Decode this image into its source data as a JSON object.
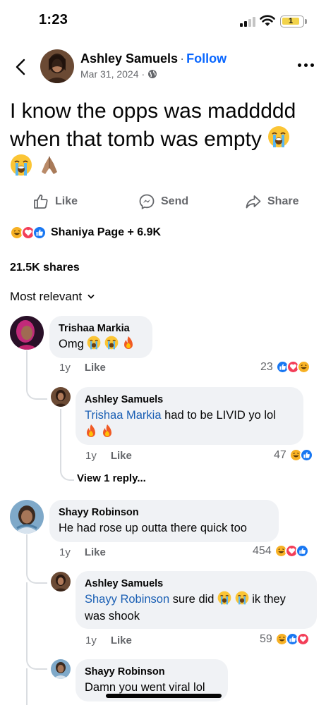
{
  "status_bar": {
    "time": "1:23",
    "battery": "1"
  },
  "post": {
    "author": "Ashley Samuels",
    "separator": "·",
    "follow_label": "Follow",
    "date": "Mar 31, 2024",
    "date_sep": "·",
    "audience_icon": "globe-icon",
    "text": "I know the opps was maddddd when that tomb was empty",
    "text_emoji": [
      "loudly-crying-face",
      "loudly-crying-face",
      "folded-hands"
    ]
  },
  "actions": {
    "like": "Like",
    "send": "Send",
    "share": "Share"
  },
  "reactions": {
    "icons": [
      "haha",
      "love",
      "like"
    ],
    "summary": "Shaniya Page + 6.9K"
  },
  "shares": "21.5K shares",
  "sort_label": "Most relevant",
  "comments": [
    {
      "author": "Trishaa Markia",
      "text": "Omg",
      "emoji": [
        "loudly-crying-face",
        "loudly-crying-face",
        "fire"
      ],
      "time": "1y",
      "like_label": "Like",
      "count": "23",
      "reaction_icons": [
        "like",
        "love",
        "haha"
      ],
      "replies": [
        {
          "author": "Ashley Samuels",
          "mention": "Trishaa Markia",
          "text": "had to be LIVID yo lol",
          "emoji": [
            "fire",
            "fire"
          ],
          "time": "1y",
          "like_label": "Like",
          "count": "47",
          "reaction_icons": [
            "haha",
            "like"
          ]
        }
      ],
      "view_more": "View 1 reply..."
    },
    {
      "author": "Shayy Robinson",
      "text": "He had rose up outta there quick too",
      "time": "1y",
      "like_label": "Like",
      "count": "454",
      "reaction_icons": [
        "haha",
        "love",
        "like"
      ],
      "replies": [
        {
          "author": "Ashley Samuels",
          "mention": "Shayy Robinson",
          "text_before": "sure did",
          "emoji": [
            "loudly-crying-face",
            "loudly-crying-face"
          ],
          "text_after": "ik they",
          "text_line2": "was shook",
          "time": "1y",
          "like_label": "Like",
          "count": "59",
          "reaction_icons": [
            "haha",
            "like",
            "love"
          ]
        },
        {
          "author": "Shayy Robinson",
          "text": "Damn you went viral lol"
        }
      ]
    }
  ],
  "colors": {
    "accent": "#0866ff",
    "mention": "#1a5fb4",
    "bubble": "#f0f2f5",
    "muted": "#65676b",
    "like": "#1877f2",
    "love": "#f33e58",
    "haha": "#f7b125"
  }
}
